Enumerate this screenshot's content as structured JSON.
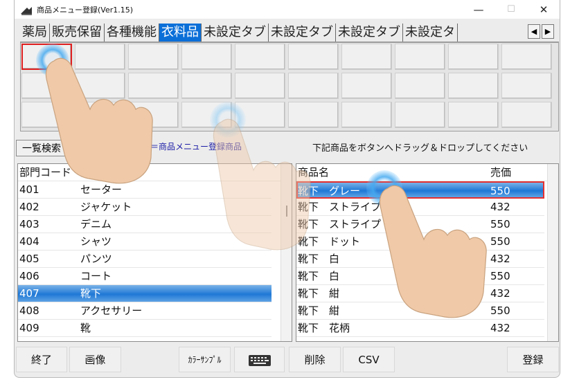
{
  "window": {
    "title": "商品メニュー登録(Ver1.15)",
    "minimize": "—",
    "maximize": "☐",
    "close": "✕"
  },
  "tabs": [
    {
      "label": "薬局",
      "active": false
    },
    {
      "label": "販売保留",
      "active": false
    },
    {
      "label": "各種機能",
      "active": false
    },
    {
      "label": "衣料品",
      "active": true
    },
    {
      "label": "未設定タブ",
      "active": false
    },
    {
      "label": "未設定タブ",
      "active": false
    },
    {
      "label": "未設定タブ",
      "active": false
    },
    {
      "label": "未設定タ",
      "active": false
    }
  ],
  "tab_scroll": {
    "left": "◀",
    "right": "▶"
  },
  "toolbar": {
    "ichiran_label": "一覧検索",
    "legend_text": "ー文字＝商品メニュー登録商品",
    "hint_text": "下記商品をボタンへドラッグ＆ドロップしてください"
  },
  "departments": {
    "header": {
      "code": "部門コード",
      "name": "部"
    },
    "rows": [
      {
        "code": "401",
        "name": "セーター",
        "selected": false
      },
      {
        "code": "402",
        "name": "ジャケット",
        "selected": false
      },
      {
        "code": "403",
        "name": "デニム",
        "selected": false
      },
      {
        "code": "404",
        "name": "シャツ",
        "selected": false
      },
      {
        "code": "405",
        "name": "パンツ",
        "selected": false
      },
      {
        "code": "406",
        "name": "コート",
        "selected": false
      },
      {
        "code": "407",
        "name": "靴下",
        "selected": true
      },
      {
        "code": "408",
        "name": "アクセサリー",
        "selected": false
      },
      {
        "code": "409",
        "name": "靴",
        "selected": false
      }
    ]
  },
  "products": {
    "header": {
      "name": "商品名",
      "price": "売価"
    },
    "rows": [
      {
        "name": "靴下　グレー",
        "price": "550",
        "selected": true
      },
      {
        "name": "靴下　ストライプ",
        "price": "432",
        "selected": false
      },
      {
        "name": "靴下　ストライプ",
        "price": "550",
        "selected": false
      },
      {
        "name": "靴下　ドット",
        "price": "550",
        "selected": false
      },
      {
        "name": "靴下　白",
        "price": "432",
        "selected": false
      },
      {
        "name": "靴下　白",
        "price": "550",
        "selected": false
      },
      {
        "name": "靴下　紺",
        "price": "432",
        "selected": false
      },
      {
        "name": "靴下　紺",
        "price": "550",
        "selected": false
      },
      {
        "name": "靴下　花柄",
        "price": "432",
        "selected": false
      }
    ]
  },
  "footer": {
    "exit": "終了",
    "image": "画像",
    "color_sample": "ｶﾗｰｻﾝﾌﾟﾙ",
    "keyboard": "keyboard-icon",
    "delete": "削除",
    "csv": "CSV",
    "register": "登録"
  },
  "colors": {
    "accent": "#0b6fd8",
    "selection_border": "#e02020",
    "legend_text": "#1a1aa6"
  }
}
